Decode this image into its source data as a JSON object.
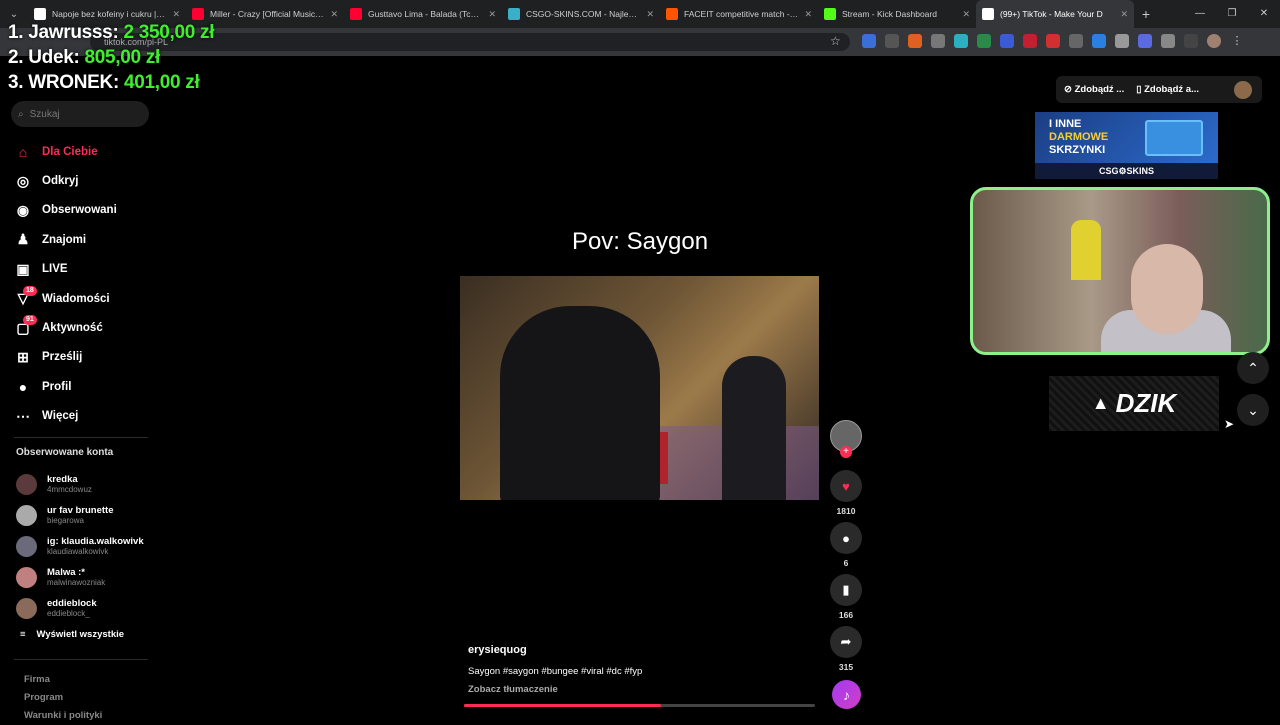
{
  "browser": {
    "tabs": [
      {
        "label": "Napoje bez kofeiny i cukru | Wi",
        "color": "#ffffff"
      },
      {
        "label": "Miller - Crazy [Official Music Vi",
        "color": "#ff0033"
      },
      {
        "label": "Gusttavo Lima - Balada (Tchê Tc",
        "color": "#ff0033"
      },
      {
        "label": "CSGO-SKINS.COM - Najlepsze",
        "color": "#3ab0c8"
      },
      {
        "label": "FACEIT competitive match - FAC",
        "color": "#ff5500"
      },
      {
        "label": "Stream - Kick Dashboard",
        "color": "#53fc18"
      },
      {
        "label": "(99+) TikTok - Make Your D",
        "color": "#ffffff"
      }
    ],
    "url": "tiktok.com/pl-PL"
  },
  "stream_overlay": {
    "ranking": [
      {
        "place": "1. Jawrusss:",
        "amount": "2 350,00 zł"
      },
      {
        "place": "2. Udek:",
        "amount": "805,00 zł"
      },
      {
        "place": "3. WRONEK:",
        "amount": "401,00 zł"
      }
    ]
  },
  "sidebar": {
    "search_placeholder": "Szukaj",
    "items": [
      {
        "label": "Dla Ciebie",
        "icon": "home-icon",
        "glyph": "⌂"
      },
      {
        "label": "Odkryj",
        "icon": "compass-icon",
        "glyph": "◎"
      },
      {
        "label": "Obserwowani",
        "icon": "following-icon",
        "glyph": "◉"
      },
      {
        "label": "Znajomi",
        "icon": "friends-icon",
        "glyph": "♟"
      },
      {
        "label": "LIVE",
        "icon": "live-icon",
        "glyph": "▣"
      },
      {
        "label": "Wiadomości",
        "icon": "messages-icon",
        "glyph": "▽",
        "badge": "18"
      },
      {
        "label": "Aktywność",
        "icon": "activity-icon",
        "glyph": "▢",
        "badge": "91"
      },
      {
        "label": "Prześlij",
        "icon": "upload-icon",
        "glyph": "⊞"
      },
      {
        "label": "Profil",
        "icon": "profile-icon",
        "glyph": "●"
      },
      {
        "label": "Więcej",
        "icon": "more-icon",
        "glyph": "⋯"
      }
    ],
    "followed_title": "Obserwowane konta",
    "followed": [
      {
        "name": "kredka",
        "handle": "4mmcdowuz"
      },
      {
        "name": "ur fav brunette",
        "handle": "biegarowa"
      },
      {
        "name": "ig: klaudia.walkowivk",
        "handle": "klaudiawalkowivk"
      },
      {
        "name": "Malwa :*",
        "handle": "malwinawozniak"
      },
      {
        "name": "eddieblock",
        "handle": "eddieblock_"
      }
    ],
    "see_all": "Wyświetl wszystkie",
    "footer": [
      "Firma",
      "Program",
      "Warunki i polityki"
    ]
  },
  "video": {
    "title": "Pov: Saygon",
    "author": "erysiequog",
    "description": "Saygon #saygon #bungee #viral #dc #fyp",
    "translate": "Zobacz tłumaczenie",
    "progress": 0.56,
    "likes": "1810",
    "comments": "6",
    "saves": "166",
    "shares": "315"
  },
  "right_panel": {
    "btn1": "Zdobądź ...",
    "btn2": "Zdobądź a...",
    "ad_line1": "I INNE",
    "ad_line2": "DARMOWE",
    "ad_line3": "SKRZYNKI",
    "ad_brand": "CSG⚙SKINS",
    "sponsor": "DZIK"
  }
}
